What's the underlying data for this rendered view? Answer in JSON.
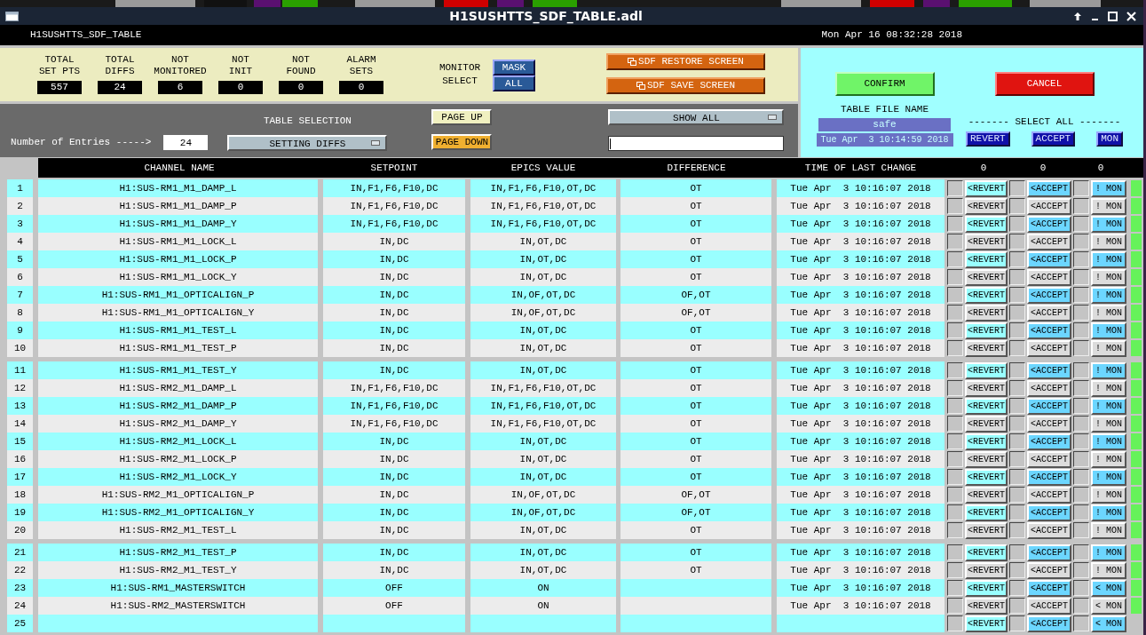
{
  "window": {
    "title": "H1SUSHTTS_SDF_TABLE.adl"
  },
  "header": {
    "screen_name": "H1SUSHTTS_SDF_TABLE",
    "datetime": "Mon Apr 16 08:32:28 2018"
  },
  "stats": [
    {
      "label": "TOTAL\nSET PTS",
      "value": "557"
    },
    {
      "label": "TOTAL\nDIFFS",
      "value": "24"
    },
    {
      "label": "NOT\nMONITORED",
      "value": "6"
    },
    {
      "label": "NOT\nINIT",
      "value": "0"
    },
    {
      "label": "NOT\nFOUND",
      "value": "0"
    },
    {
      "label": "ALARM\nSETS",
      "value": "0"
    }
  ],
  "monitor_select": {
    "label": "MONITOR\nSELECT",
    "buttons": [
      "MASK",
      "ALL"
    ]
  },
  "sdf_buttons": [
    "SDF RESTORE SCREEN",
    "SDF SAVE SCREEN"
  ],
  "entries": {
    "label": "Number of Entries ----->",
    "value": "24"
  },
  "table_selection": {
    "label": "TABLE SELECTION",
    "value": "SETTING DIFFS"
  },
  "paging": [
    {
      "label": "PAGE UP",
      "kind": "up"
    },
    {
      "label": "PAGE DOWN",
      "kind": "down"
    }
  ],
  "filter": {
    "value": "SHOW ALL"
  },
  "actions": [
    {
      "label": "CONFIRM",
      "kind": "confirm"
    },
    {
      "label": "CANCEL",
      "kind": "cancel"
    }
  ],
  "table_file": {
    "label": "TABLE FILE NAME",
    "name": "safe",
    "time": "Tue Apr  3 10:14:59 2018"
  },
  "select_all": {
    "label": "------- SELECT ALL -------",
    "buttons": [
      "REVERT",
      "ACCEPT",
      "MON"
    ]
  },
  "table": {
    "columns": [
      "CHANNEL NAME",
      "SETPOINT",
      "EPICS VALUE",
      "DIFFERENCE",
      "TIME OF LAST CHANGE"
    ],
    "counts": [
      "0",
      "0",
      "0"
    ],
    "rows": [
      {
        "number": "1",
        "channel": "H1:SUS-RM1_M1_DAMP_L",
        "setpoint": "IN,F1,F6,F10,DC",
        "epics_value": "IN,F1,F6,F10,OT,DC",
        "difference": "OT",
        "time": "Tue Apr  3 10:16:07 2018",
        "revert_checked": false,
        "revert": "<REVERT",
        "accept_checked": false,
        "accept": "<ACCEPT",
        "mon_checked": false,
        "mon": "! MON",
        "color": "#66f25a"
      },
      {
        "number": "2",
        "channel": "H1:SUS-RM1_M1_DAMP_P",
        "setpoint": "IN,F1,F6,F10,DC",
        "epics_value": "IN,F1,F6,F10,OT,DC",
        "difference": "OT",
        "time": "Tue Apr  3 10:16:07 2018",
        "revert_checked": false,
        "revert": "<REVERT",
        "accept_checked": false,
        "accept": "<ACCEPT",
        "mon_checked": false,
        "mon": "! MON",
        "color": "#66f25a"
      },
      {
        "number": "3",
        "channel": "H1:SUS-RM1_M1_DAMP_Y",
        "setpoint": "IN,F1,F6,F10,DC",
        "epics_value": "IN,F1,F6,F10,OT,DC",
        "difference": "OT",
        "time": "Tue Apr  3 10:16:07 2018",
        "revert_checked": false,
        "revert": "<REVERT",
        "accept_checked": false,
        "accept": "<ACCEPT",
        "mon_checked": false,
        "mon": "! MON",
        "color": "#66f25a"
      },
      {
        "number": "4",
        "channel": "H1:SUS-RM1_M1_LOCK_L",
        "setpoint": "IN,DC",
        "epics_value": "IN,OT,DC",
        "difference": "OT",
        "time": "Tue Apr  3 10:16:07 2018",
        "revert_checked": false,
        "revert": "<REVERT",
        "accept_checked": false,
        "accept": "<ACCEPT",
        "mon_checked": false,
        "mon": "! MON",
        "color": "#66f25a"
      },
      {
        "number": "5",
        "channel": "H1:SUS-RM1_M1_LOCK_P",
        "setpoint": "IN,DC",
        "epics_value": "IN,OT,DC",
        "difference": "OT",
        "time": "Tue Apr  3 10:16:07 2018",
        "revert_checked": false,
        "revert": "<REVERT",
        "accept_checked": false,
        "accept": "<ACCEPT",
        "mon_checked": false,
        "mon": "! MON",
        "color": "#66f25a"
      },
      {
        "number": "6",
        "channel": "H1:SUS-RM1_M1_LOCK_Y",
        "setpoint": "IN,DC",
        "epics_value": "IN,OT,DC",
        "difference": "OT",
        "time": "Tue Apr  3 10:16:07 2018",
        "revert_checked": false,
        "revert": "<REVERT",
        "accept_checked": false,
        "accept": "<ACCEPT",
        "mon_checked": false,
        "mon": "! MON",
        "color": "#66f25a"
      },
      {
        "number": "7",
        "channel": "H1:SUS-RM1_M1_OPTICALIGN_P",
        "setpoint": "IN,DC",
        "epics_value": "IN,OF,OT,DC",
        "difference": "OF,OT",
        "time": "Tue Apr  3 10:16:07 2018",
        "revert_checked": false,
        "revert": "<REVERT",
        "accept_checked": false,
        "accept": "<ACCEPT",
        "mon_checked": false,
        "mon": "! MON",
        "color": "#66f25a"
      },
      {
        "number": "8",
        "channel": "H1:SUS-RM1_M1_OPTICALIGN_Y",
        "setpoint": "IN,DC",
        "epics_value": "IN,OF,OT,DC",
        "difference": "OF,OT",
        "time": "Tue Apr  3 10:16:07 2018",
        "revert_checked": false,
        "revert": "<REVERT",
        "accept_checked": false,
        "accept": "<ACCEPT",
        "mon_checked": false,
        "mon": "! MON",
        "color": "#66f25a"
      },
      {
        "number": "9",
        "channel": "H1:SUS-RM1_M1_TEST_L",
        "setpoint": "IN,DC",
        "epics_value": "IN,OT,DC",
        "difference": "OT",
        "time": "Tue Apr  3 10:16:07 2018",
        "revert_checked": false,
        "revert": "<REVERT",
        "accept_checked": false,
        "accept": "<ACCEPT",
        "mon_checked": false,
        "mon": "! MON",
        "color": "#66f25a"
      },
      {
        "number": "10",
        "channel": "H1:SUS-RM1_M1_TEST_P",
        "setpoint": "IN,DC",
        "epics_value": "IN,OT,DC",
        "difference": "OT",
        "time": "Tue Apr  3 10:16:07 2018",
        "revert_checked": false,
        "revert": "<REVERT",
        "accept_checked": false,
        "accept": "<ACCEPT",
        "mon_checked": false,
        "mon": "! MON",
        "color": "#66f25a"
      },
      {
        "number": "11",
        "channel": "H1:SUS-RM1_M1_TEST_Y",
        "setpoint": "IN,DC",
        "epics_value": "IN,OT,DC",
        "difference": "OT",
        "time": "Tue Apr  3 10:16:07 2018",
        "revert_checked": false,
        "revert": "<REVERT",
        "accept_checked": false,
        "accept": "<ACCEPT",
        "mon_checked": false,
        "mon": "! MON",
        "color": "#66f25a"
      },
      {
        "number": "12",
        "channel": "H1:SUS-RM2_M1_DAMP_L",
        "setpoint": "IN,F1,F6,F10,DC",
        "epics_value": "IN,F1,F6,F10,OT,DC",
        "difference": "OT",
        "time": "Tue Apr  3 10:16:07 2018",
        "revert_checked": false,
        "revert": "<REVERT",
        "accept_checked": false,
        "accept": "<ACCEPT",
        "mon_checked": false,
        "mon": "! MON",
        "color": "#66f25a"
      },
      {
        "number": "13",
        "channel": "H1:SUS-RM2_M1_DAMP_P",
        "setpoint": "IN,F1,F6,F10,DC",
        "epics_value": "IN,F1,F6,F10,OT,DC",
        "difference": "OT",
        "time": "Tue Apr  3 10:16:07 2018",
        "revert_checked": false,
        "revert": "<REVERT",
        "accept_checked": false,
        "accept": "<ACCEPT",
        "mon_checked": false,
        "mon": "! MON",
        "color": "#66f25a"
      },
      {
        "number": "14",
        "channel": "H1:SUS-RM2_M1_DAMP_Y",
        "setpoint": "IN,F1,F6,F10,DC",
        "epics_value": "IN,F1,F6,F10,OT,DC",
        "difference": "OT",
        "time": "Tue Apr  3 10:16:07 2018",
        "revert_checked": false,
        "revert": "<REVERT",
        "accept_checked": false,
        "accept": "<ACCEPT",
        "mon_checked": false,
        "mon": "! MON",
        "color": "#66f25a"
      },
      {
        "number": "15",
        "channel": "H1:SUS-RM2_M1_LOCK_L",
        "setpoint": "IN,DC",
        "epics_value": "IN,OT,DC",
        "difference": "OT",
        "time": "Tue Apr  3 10:16:07 2018",
        "revert_checked": false,
        "revert": "<REVERT",
        "accept_checked": false,
        "accept": "<ACCEPT",
        "mon_checked": false,
        "mon": "! MON",
        "color": "#66f25a"
      },
      {
        "number": "16",
        "channel": "H1:SUS-RM2_M1_LOCK_P",
        "setpoint": "IN,DC",
        "epics_value": "IN,OT,DC",
        "difference": "OT",
        "time": "Tue Apr  3 10:16:07 2018",
        "revert_checked": false,
        "revert": "<REVERT",
        "accept_checked": false,
        "accept": "<ACCEPT",
        "mon_checked": false,
        "mon": "! MON",
        "color": "#66f25a"
      },
      {
        "number": "17",
        "channel": "H1:SUS-RM2_M1_LOCK_Y",
        "setpoint": "IN,DC",
        "epics_value": "IN,OT,DC",
        "difference": "OT",
        "time": "Tue Apr  3 10:16:07 2018",
        "revert_checked": false,
        "revert": "<REVERT",
        "accept_checked": false,
        "accept": "<ACCEPT",
        "mon_checked": false,
        "mon": "! MON",
        "color": "#66f25a"
      },
      {
        "number": "18",
        "channel": "H1:SUS-RM2_M1_OPTICALIGN_P",
        "setpoint": "IN,DC",
        "epics_value": "IN,OF,OT,DC",
        "difference": "OF,OT",
        "time": "Tue Apr  3 10:16:07 2018",
        "revert_checked": false,
        "revert": "<REVERT",
        "accept_checked": false,
        "accept": "<ACCEPT",
        "mon_checked": false,
        "mon": "! MON",
        "color": "#66f25a"
      },
      {
        "number": "19",
        "channel": "H1:SUS-RM2_M1_OPTICALIGN_Y",
        "setpoint": "IN,DC",
        "epics_value": "IN,OF,OT,DC",
        "difference": "OF,OT",
        "time": "Tue Apr  3 10:16:07 2018",
        "revert_checked": false,
        "revert": "<REVERT",
        "accept_checked": false,
        "accept": "<ACCEPT",
        "mon_checked": false,
        "mon": "! MON",
        "color": "#66f25a"
      },
      {
        "number": "20",
        "channel": "H1:SUS-RM2_M1_TEST_L",
        "setpoint": "IN,DC",
        "epics_value": "IN,OT,DC",
        "difference": "OT",
        "time": "Tue Apr  3 10:16:07 2018",
        "revert_checked": false,
        "revert": "<REVERT",
        "accept_checked": false,
        "accept": "<ACCEPT",
        "mon_checked": false,
        "mon": "! MON",
        "color": "#66f25a"
      },
      {
        "number": "21",
        "channel": "H1:SUS-RM2_M1_TEST_P",
        "setpoint": "IN,DC",
        "epics_value": "IN,OT,DC",
        "difference": "OT",
        "time": "Tue Apr  3 10:16:07 2018",
        "revert_checked": false,
        "revert": "<REVERT",
        "accept_checked": false,
        "accept": "<ACCEPT",
        "mon_checked": false,
        "mon": "! MON",
        "color": "#66f25a"
      },
      {
        "number": "22",
        "channel": "H1:SUS-RM2_M1_TEST_Y",
        "setpoint": "IN,DC",
        "epics_value": "IN,OT,DC",
        "difference": "OT",
        "time": "Tue Apr  3 10:16:07 2018",
        "revert_checked": false,
        "revert": "<REVERT",
        "accept_checked": false,
        "accept": "<ACCEPT",
        "mon_checked": false,
        "mon": "! MON",
        "color": "#66f25a"
      },
      {
        "number": "23",
        "channel": "H1:SUS-RM1_MASTERSWITCH",
        "setpoint": "OFF",
        "epics_value": "ON",
        "time": "Tue Apr  3 10:16:07 2018",
        "revert_checked": false,
        "revert": "<REVERT",
        "accept_checked": false,
        "accept": "<ACCEPT",
        "mon_checked": false,
        "mon": "< MON",
        "color": "#66f25a"
      },
      {
        "number": "24",
        "channel": "H1:SUS-RM2_MASTERSWITCH",
        "setpoint": "OFF",
        "epics_value": "ON",
        "time": "Tue Apr  3 10:16:07 2018",
        "revert_checked": false,
        "revert": "<REVERT",
        "accept_checked": false,
        "accept": "<ACCEPT",
        "mon_checked": false,
        "mon": "< MON",
        "color": "#66f25a"
      },
      {
        "number": "25",
        "revert_checked": false,
        "revert": "<REVERT",
        "accept_checked": false,
        "accept": "<ACCEPT",
        "mon_checked": false,
        "mon": "< MON"
      }
    ]
  }
}
